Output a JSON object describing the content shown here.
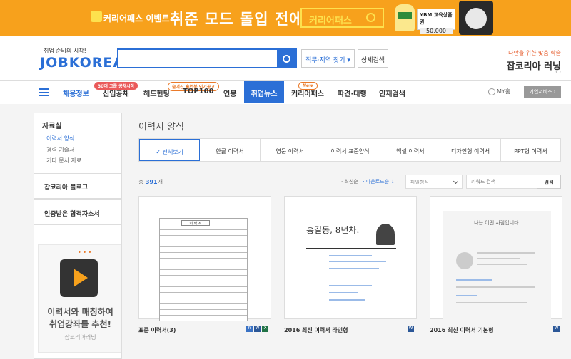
{
  "banner": {
    "event_label": "커리어패스 이벤트",
    "headline": "취준 모드 돌입 전에",
    "box_label": "커리어패스",
    "card_title": "YBM 교육상품권",
    "card_value": "50,000"
  },
  "header": {
    "logo_tag": "취업 준비의 시작!",
    "logo_name": "JOBKOREA",
    "search_placeholder": "",
    "job_select": "직무·지역 찾기",
    "advanced_search": "상세검색",
    "right_tag": "나만을 위한 맞춤 학습",
    "right_title": "잡코리아 러닝"
  },
  "nav": {
    "items": [
      "채용정보",
      "신입공채",
      "헤드헌팅",
      "TOP100",
      "연봉",
      "취업뉴스",
      "커리어패스",
      "파견·대행",
      "인재검색"
    ],
    "badges": [
      "30대 그룹 공채시작",
      "숨겨진 高연봉 인기공고",
      "New"
    ],
    "my": "MY홈",
    "corp": "기업서비스"
  },
  "sidebar": {
    "heading": "자료실",
    "sub_items": [
      "이력서 양식",
      "경력 기술서",
      "기타 문서 자료"
    ],
    "section1": "잡코리아 블로그",
    "section2": "인증받은 합격자소서",
    "ad_line1": "이력서와 매칭하여",
    "ad_line2": "취업강좌를 추천!",
    "ad_sub": "잡코리아러닝"
  },
  "main": {
    "title": "이력서 양식",
    "tabs": [
      "✓ 전체보기",
      "한글 이력서",
      "영문 이력서",
      "이력서 표준양식",
      "엑셀 이력서",
      "디자인형 이력서",
      "PPT형 이력서"
    ],
    "count_prefix": "총",
    "count_value": "391",
    "count_suffix": "개",
    "sort_latest": "· 최신순",
    "sort_download": "· 다운로드순 ↓",
    "file_type_placeholder": "파일형식",
    "keyword_placeholder": "키워드 검색",
    "search_btn": "검색",
    "cards": [
      {
        "name": "표준 이력서(3)",
        "doc_title": "이 력 서"
      },
      {
        "name": "2016 최신 이력서 라인형",
        "doc_title": "홍길동, 8년차."
      },
      {
        "name": "2016 최신 이력서 기본형",
        "doc_title": "나는 어떤 사람입니다."
      }
    ]
  }
}
